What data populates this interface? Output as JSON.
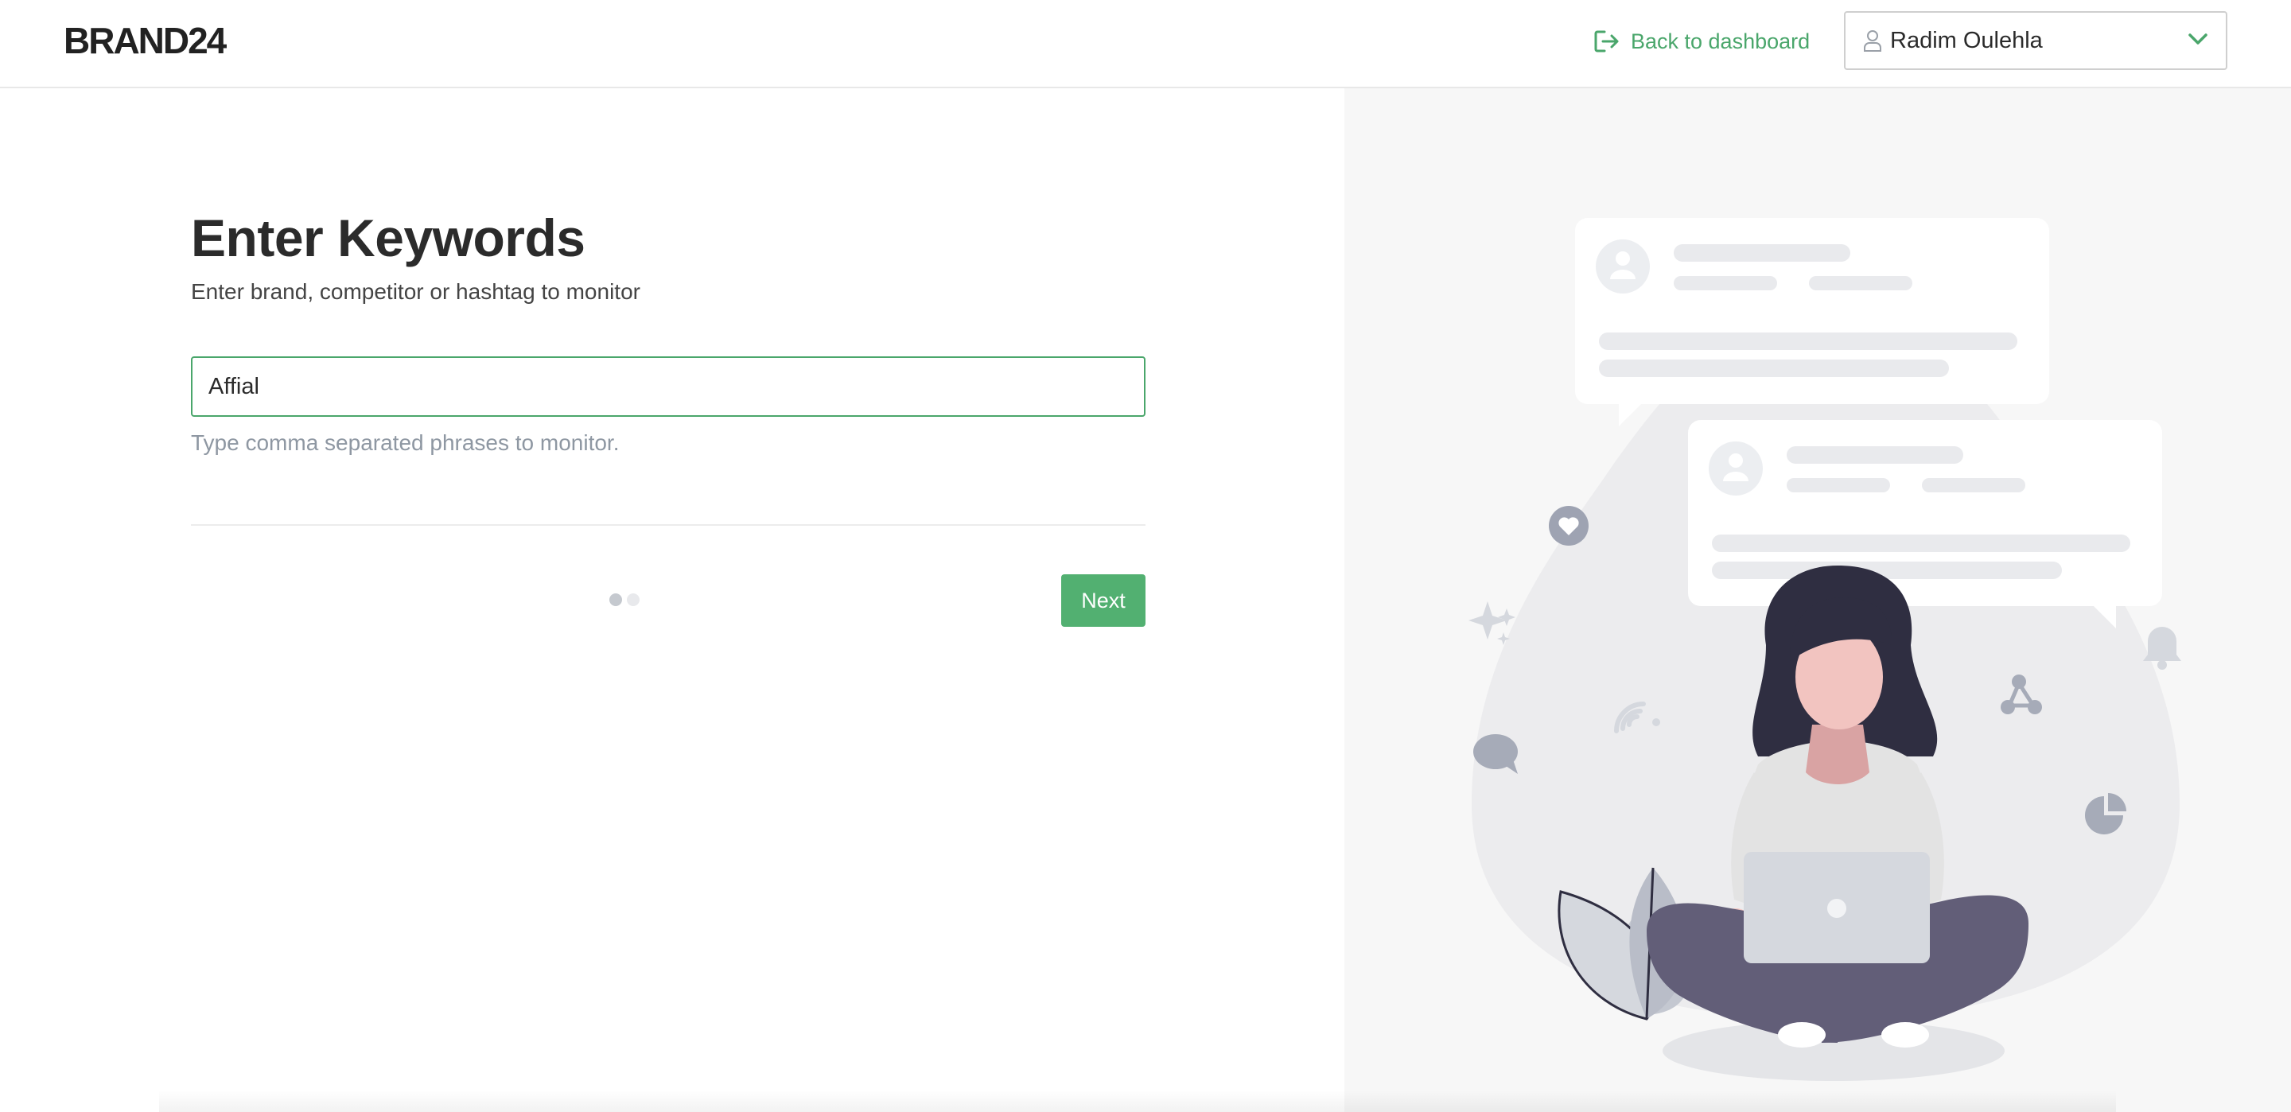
{
  "header": {
    "logo_text": "BRAND24",
    "back_link_label": "Back to dashboard",
    "user_name": "Radim Oulehla"
  },
  "main": {
    "title": "Enter Keywords",
    "subtitle": "Enter brand, competitor or hashtag to monitor",
    "keyword_input_value": "Affial",
    "hint": "Type comma separated phrases to monitor.",
    "next_label": "Next",
    "steps": {
      "current": 1,
      "total": 2
    }
  },
  "icons": {
    "back": "exit-arrow-icon",
    "user": "user-icon",
    "dropdown": "chevron-down-icon"
  },
  "colors": {
    "accent": "#52b071",
    "link": "#4aa66b",
    "panel_bg": "#f7f7f7",
    "illustration_hair": "#2f2e41",
    "illustration_pants": "#625e78"
  }
}
